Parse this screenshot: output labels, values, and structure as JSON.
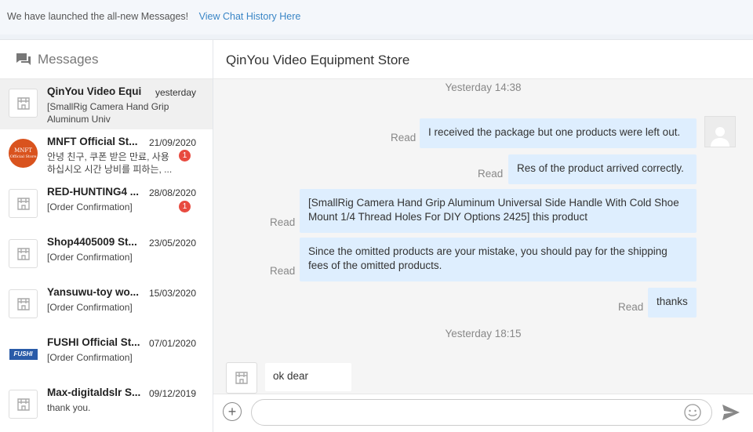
{
  "banner": {
    "text": "We have launched the all-new Messages!",
    "link": "View Chat History Here"
  },
  "sidebar": {
    "title": "Messages",
    "icon": "chat-bubbles-icon",
    "conversations": [
      {
        "name": "QinYou Video Equi...",
        "date": "yesterday",
        "preview": "[SmallRig Camera Hand Grip Aluminum Univ",
        "avatar": "store-icon",
        "active": true
      },
      {
        "name": "MNFT Official St...",
        "date": "21/09/2020",
        "preview": "안녕 친구, 쿠폰 받은 만료, 사용하십시오 시간 낭비를 피하는, ...",
        "avatar": "mnft-logo",
        "avatar_text": "MNFT",
        "avatar_sub": "Official Store",
        "badge": "1"
      },
      {
        "name": "RED-HUNTING4 ...",
        "date": "28/08/2020",
        "preview": "[Order Confirmation]",
        "avatar": "store-icon",
        "badge": "1"
      },
      {
        "name": "Shop4405009 St...",
        "date": "23/05/2020",
        "preview": "[Order Confirmation]",
        "avatar": "store-icon"
      },
      {
        "name": "Yansuwu-toy wo...",
        "date": "15/03/2020",
        "preview": "[Order Confirmation]",
        "avatar": "store-icon"
      },
      {
        "name": "FUSHI Official St...",
        "date": "07/01/2020",
        "preview": "[Order Confirmation]",
        "avatar": "fushi-logo",
        "avatar_text": "FUSHI"
      },
      {
        "name": "Max-digitaldslr S...",
        "date": "09/12/2019",
        "preview": "thank you.",
        "avatar": "store-icon"
      }
    ]
  },
  "chat": {
    "title": "QinYou Video Equipment Store",
    "timestamp1": "Yesterday 14:38",
    "timestamp2": "Yesterday 18:15",
    "read_label": "Read",
    "outgoing": [
      "I received the package but one products were left out.",
      "Res of the product arrived correctly.",
      "[SmallRig Camera Hand Grip Aluminum Universal Side Handle With Cold Shoe Mount 1/4 Thread Holes For DIY Options 2425] this product",
      "Since the omitted products are your mistake, you should pay for the shipping fees of the omitted products.",
      "thanks"
    ],
    "incoming": [
      "ok dear"
    ]
  },
  "composer": {
    "placeholder": "",
    "plus_icon": "plus-icon",
    "emoji_icon": "emoji-icon",
    "send_icon": "send-icon"
  },
  "colors": {
    "outgoing_bubble": "#deeefe",
    "badge": "#e84a3f",
    "link": "#3a86c6"
  }
}
